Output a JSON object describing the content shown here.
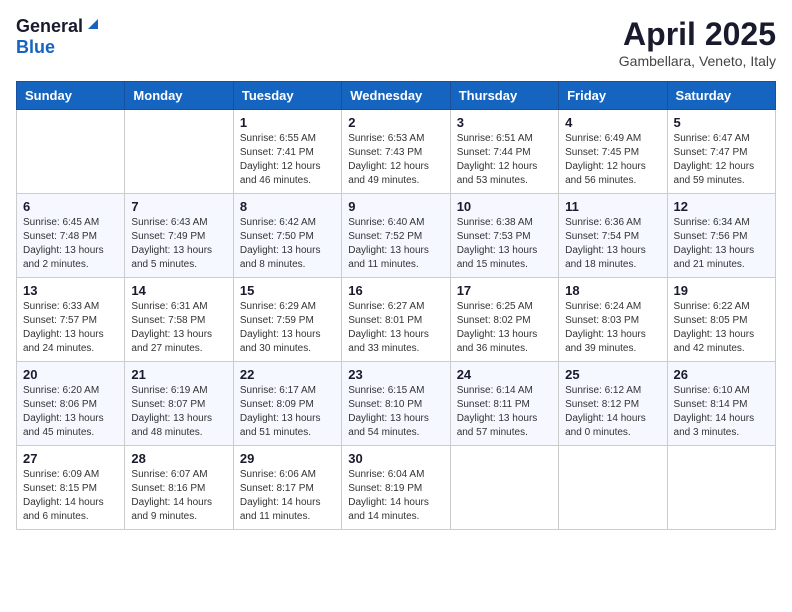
{
  "header": {
    "logo_general": "General",
    "logo_blue": "Blue",
    "month_title": "April 2025",
    "location": "Gambellara, Veneto, Italy"
  },
  "days_of_week": [
    "Sunday",
    "Monday",
    "Tuesday",
    "Wednesday",
    "Thursday",
    "Friday",
    "Saturday"
  ],
  "weeks": [
    [
      {
        "day": "",
        "info": ""
      },
      {
        "day": "",
        "info": ""
      },
      {
        "day": "1",
        "info": "Sunrise: 6:55 AM\nSunset: 7:41 PM\nDaylight: 12 hours and 46 minutes."
      },
      {
        "day": "2",
        "info": "Sunrise: 6:53 AM\nSunset: 7:43 PM\nDaylight: 12 hours and 49 minutes."
      },
      {
        "day": "3",
        "info": "Sunrise: 6:51 AM\nSunset: 7:44 PM\nDaylight: 12 hours and 53 minutes."
      },
      {
        "day": "4",
        "info": "Sunrise: 6:49 AM\nSunset: 7:45 PM\nDaylight: 12 hours and 56 minutes."
      },
      {
        "day": "5",
        "info": "Sunrise: 6:47 AM\nSunset: 7:47 PM\nDaylight: 12 hours and 59 minutes."
      }
    ],
    [
      {
        "day": "6",
        "info": "Sunrise: 6:45 AM\nSunset: 7:48 PM\nDaylight: 13 hours and 2 minutes."
      },
      {
        "day": "7",
        "info": "Sunrise: 6:43 AM\nSunset: 7:49 PM\nDaylight: 13 hours and 5 minutes."
      },
      {
        "day": "8",
        "info": "Sunrise: 6:42 AM\nSunset: 7:50 PM\nDaylight: 13 hours and 8 minutes."
      },
      {
        "day": "9",
        "info": "Sunrise: 6:40 AM\nSunset: 7:52 PM\nDaylight: 13 hours and 11 minutes."
      },
      {
        "day": "10",
        "info": "Sunrise: 6:38 AM\nSunset: 7:53 PM\nDaylight: 13 hours and 15 minutes."
      },
      {
        "day": "11",
        "info": "Sunrise: 6:36 AM\nSunset: 7:54 PM\nDaylight: 13 hours and 18 minutes."
      },
      {
        "day": "12",
        "info": "Sunrise: 6:34 AM\nSunset: 7:56 PM\nDaylight: 13 hours and 21 minutes."
      }
    ],
    [
      {
        "day": "13",
        "info": "Sunrise: 6:33 AM\nSunset: 7:57 PM\nDaylight: 13 hours and 24 minutes."
      },
      {
        "day": "14",
        "info": "Sunrise: 6:31 AM\nSunset: 7:58 PM\nDaylight: 13 hours and 27 minutes."
      },
      {
        "day": "15",
        "info": "Sunrise: 6:29 AM\nSunset: 7:59 PM\nDaylight: 13 hours and 30 minutes."
      },
      {
        "day": "16",
        "info": "Sunrise: 6:27 AM\nSunset: 8:01 PM\nDaylight: 13 hours and 33 minutes."
      },
      {
        "day": "17",
        "info": "Sunrise: 6:25 AM\nSunset: 8:02 PM\nDaylight: 13 hours and 36 minutes."
      },
      {
        "day": "18",
        "info": "Sunrise: 6:24 AM\nSunset: 8:03 PM\nDaylight: 13 hours and 39 minutes."
      },
      {
        "day": "19",
        "info": "Sunrise: 6:22 AM\nSunset: 8:05 PM\nDaylight: 13 hours and 42 minutes."
      }
    ],
    [
      {
        "day": "20",
        "info": "Sunrise: 6:20 AM\nSunset: 8:06 PM\nDaylight: 13 hours and 45 minutes."
      },
      {
        "day": "21",
        "info": "Sunrise: 6:19 AM\nSunset: 8:07 PM\nDaylight: 13 hours and 48 minutes."
      },
      {
        "day": "22",
        "info": "Sunrise: 6:17 AM\nSunset: 8:09 PM\nDaylight: 13 hours and 51 minutes."
      },
      {
        "day": "23",
        "info": "Sunrise: 6:15 AM\nSunset: 8:10 PM\nDaylight: 13 hours and 54 minutes."
      },
      {
        "day": "24",
        "info": "Sunrise: 6:14 AM\nSunset: 8:11 PM\nDaylight: 13 hours and 57 minutes."
      },
      {
        "day": "25",
        "info": "Sunrise: 6:12 AM\nSunset: 8:12 PM\nDaylight: 14 hours and 0 minutes."
      },
      {
        "day": "26",
        "info": "Sunrise: 6:10 AM\nSunset: 8:14 PM\nDaylight: 14 hours and 3 minutes."
      }
    ],
    [
      {
        "day": "27",
        "info": "Sunrise: 6:09 AM\nSunset: 8:15 PM\nDaylight: 14 hours and 6 minutes."
      },
      {
        "day": "28",
        "info": "Sunrise: 6:07 AM\nSunset: 8:16 PM\nDaylight: 14 hours and 9 minutes."
      },
      {
        "day": "29",
        "info": "Sunrise: 6:06 AM\nSunset: 8:17 PM\nDaylight: 14 hours and 11 minutes."
      },
      {
        "day": "30",
        "info": "Sunrise: 6:04 AM\nSunset: 8:19 PM\nDaylight: 14 hours and 14 minutes."
      },
      {
        "day": "",
        "info": ""
      },
      {
        "day": "",
        "info": ""
      },
      {
        "day": "",
        "info": ""
      }
    ]
  ]
}
